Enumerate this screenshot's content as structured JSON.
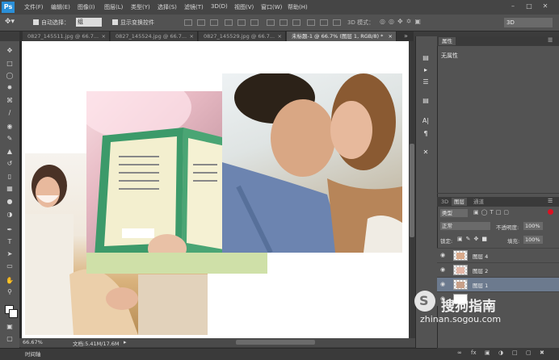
{
  "app": {
    "logo": "Ps"
  },
  "menu": [
    "文件(F)",
    "编辑(E)",
    "图像(I)",
    "图层(L)",
    "类型(Y)",
    "选择(S)",
    "滤镜(T)",
    "3D(D)",
    "视图(V)",
    "窗口(W)",
    "帮助(H)"
  ],
  "window_controls": [
    "minimize-icon",
    "maximize-icon",
    "close-icon"
  ],
  "options_bar": {
    "auto_select_label": "自动选择：",
    "auto_select_value": "组",
    "show_transform_label": "显示变换控件",
    "mode_3d_label": "3D 模式：",
    "workspace_value": "3D"
  },
  "tabs": [
    {
      "label": "0827_145511.jpg @ 66.7...",
      "active": false
    },
    {
      "label": "0827_145524.jpg @ 66.7...",
      "active": false
    },
    {
      "label": "0827_145529.jpg @ 66.7...",
      "active": false
    },
    {
      "label": "未标题-1 @ 66.7% (图层 1, RGB/8) *",
      "active": true
    }
  ],
  "tools": [
    "move-icon",
    "marquee-icon",
    "lasso-icon",
    "quick-select-icon",
    "crop-icon",
    "eyedropper-icon",
    "healing-icon",
    "brush-icon",
    "stamp-icon",
    "history-brush-icon",
    "eraser-icon",
    "gradient-icon",
    "blur-icon",
    "dodge-icon",
    "pen-icon",
    "type-icon",
    "path-select-icon",
    "shape-icon",
    "hand-icon",
    "zoom-icon"
  ],
  "status": {
    "zoom": "66.67%",
    "doc_size": "文档:5.41M/17.6M",
    "timeline_label": "时间轴"
  },
  "properties": {
    "tab": "属性",
    "body": "无属性"
  },
  "layers_panel": {
    "tabs": [
      "3D",
      "图层",
      "通道"
    ],
    "active_tab": "图层",
    "filter_value": "类型",
    "blend_mode": "正常",
    "opacity_label": "不透明度:",
    "opacity_value": "100%",
    "lock_label": "锁定:",
    "fill_label": "填充:",
    "fill_value": "100%",
    "layers": [
      {
        "name": "图层 4",
        "selected": false
      },
      {
        "name": "图层 2",
        "selected": false
      },
      {
        "name": "图层 1",
        "selected": true
      }
    ]
  },
  "watermark": {
    "text": "搜狗指南",
    "url": "zhinan.sogou.com"
  }
}
